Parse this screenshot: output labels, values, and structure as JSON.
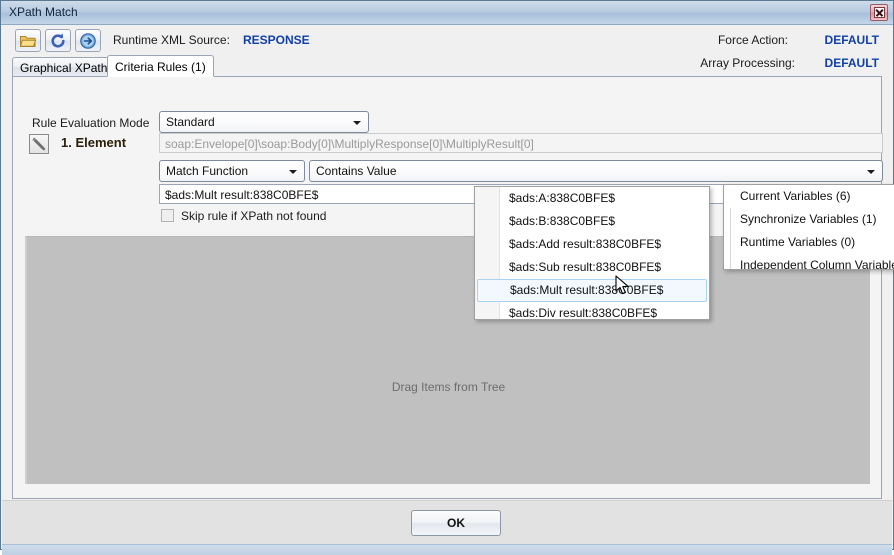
{
  "window": {
    "title": "XPath Match",
    "close_label": "Close"
  },
  "toolbar": {
    "open_icon": "folder-open-icon",
    "refresh_icon": "refresh-icon",
    "go_icon": "arrow-right-circle-icon",
    "source_label": "Runtime XML Source:",
    "source_value": "RESPONSE",
    "force_action_label": "Force Action:",
    "force_action_value": "DEFAULT",
    "array_processing_label": "Array Processing:",
    "array_processing_value": "DEFAULT"
  },
  "tabs": [
    {
      "label": "Graphical XPath",
      "active": false
    },
    {
      "label": "Criteria Rules (1)",
      "active": true
    }
  ],
  "rule": {
    "mode_label": "Rule Evaluation Mode",
    "mode_value": "Standard",
    "element_title": "1. Element",
    "element_icon": "wrench-icon",
    "xpath_value": "soap:Envelope[0]\\soap:Body[0]\\MultiplyResponse[0]\\MultiplyResult[0]",
    "match_function_value": "Match Function",
    "contains_value": "Contains Value",
    "value_field": "$ads:Mult result:838C0BFE$",
    "ellipsis_button": "...",
    "variable_button_icon": "variable-picker-icon",
    "skip_checkbox_label": "Skip rule if XPath not found",
    "skip_checked": false
  },
  "drop_area": {
    "placeholder": "Drag Items from Tree"
  },
  "footer": {
    "ok_label": "OK"
  },
  "variable_menu": {
    "items": [
      {
        "label": "$ads:A:838C0BFE$",
        "highlighted": false
      },
      {
        "label": "$ads:B:838C0BFE$",
        "highlighted": false
      },
      {
        "label": "$ads:Add result:838C0BFE$",
        "highlighted": false
      },
      {
        "label": "$ads:Sub result:838C0BFE$",
        "highlighted": false
      },
      {
        "label": "$ads:Mult result:838C0BFE$",
        "highlighted": true
      },
      {
        "label": "$ads:Div result:838C0BFE$",
        "highlighted": false
      }
    ]
  },
  "category_menu": {
    "items": [
      {
        "label": "Current Variables (6)"
      },
      {
        "label": "Synchronize Variables (1)"
      },
      {
        "label": "Runtime Variables (0)"
      },
      {
        "label": "Independent Column Variables"
      }
    ]
  }
}
